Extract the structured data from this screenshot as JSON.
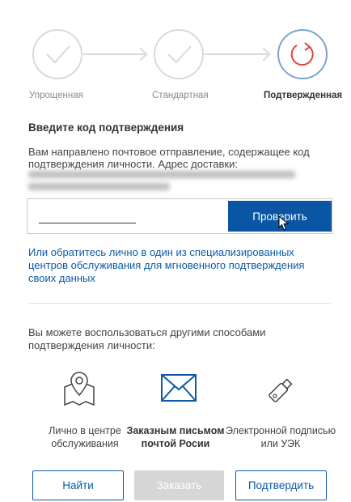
{
  "steps": [
    {
      "label": "Упрощенная"
    },
    {
      "label": "Стандартная"
    },
    {
      "label": "Подтвержденная"
    }
  ],
  "title": "Введите код подтверждения",
  "description": "Вам направлено почтовое отправление, содержащее код подтверждения личности. Адрес доставки:",
  "code_input": {
    "value": "",
    "placeholder": ""
  },
  "verify_button": "Проверить",
  "center_link": "Или обратитесь лично в один из специализированных центров обслуживания для мгновенного подтверждения своих данных",
  "alt_text": "Вы можете воспользоваться другими способами подтверждения личности:",
  "methods": [
    {
      "label": "Лично в центре обслуживания",
      "icon": "map-pin-icon"
    },
    {
      "label": "Заказным письмом почтой Росии",
      "icon": "envelope-icon"
    },
    {
      "label": "Электронной подписью или УЭК",
      "icon": "usb-key-icon"
    }
  ],
  "buttons": {
    "find": "Найти",
    "order": "Заказать",
    "confirm": "Подтвердить"
  },
  "colors": {
    "accent": "#0b56a4",
    "link": "#0b5aa6",
    "disabled": "#d6d6d6"
  }
}
